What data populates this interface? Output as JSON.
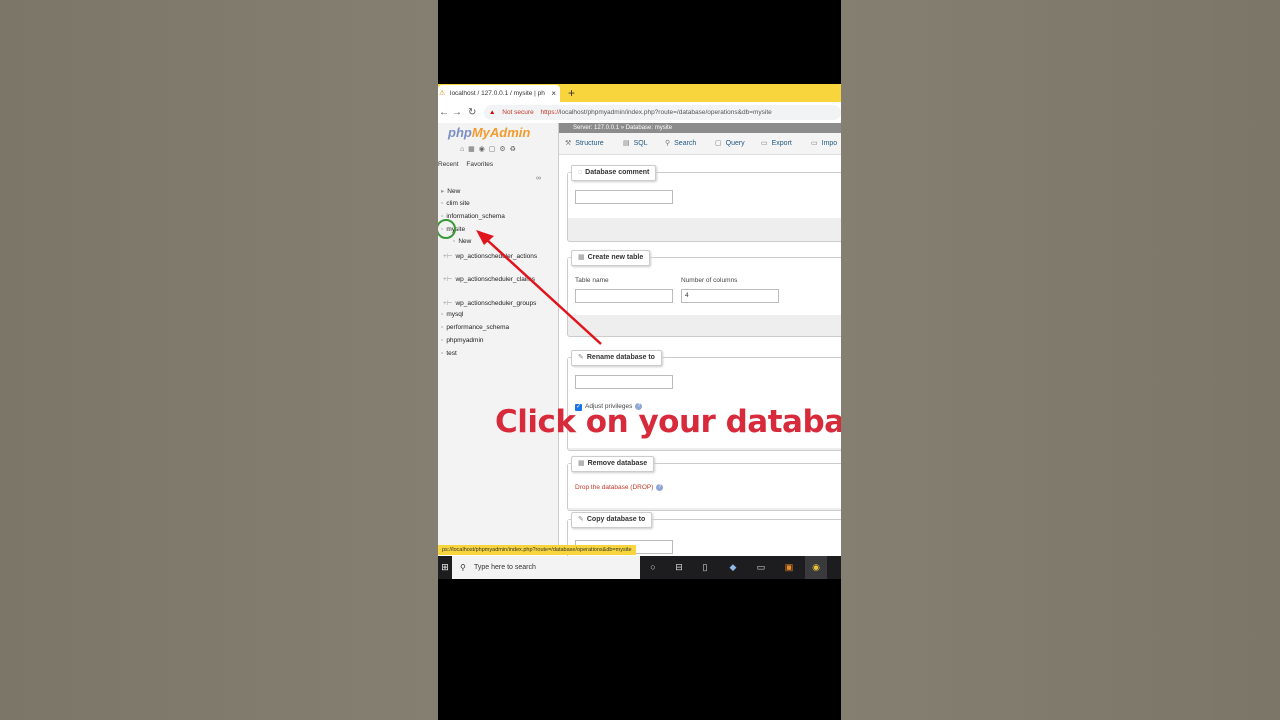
{
  "browser": {
    "tab_title": "localhost / 127.0.0.1 / mysite | ph",
    "tab_close": "×",
    "new_tab": "+",
    "not_secure": "Not secure",
    "url_scheme": "https://",
    "url_rest": "localhost/phpmyadmin/index.php?route=/database/operations&db=mysite"
  },
  "pma": {
    "logo_php": "php",
    "logo_myadmin": "MyAdmin",
    "left_tabs": [
      "Recent",
      "Favorites"
    ],
    "tree": [
      {
        "label": "New"
      },
      {
        "label": "clim site"
      },
      {
        "label": "information_schema"
      },
      {
        "label": "mysite"
      },
      {
        "label": "New"
      },
      {
        "label": "wp_actionscheduler_actions"
      },
      {
        "label": "wp_actionscheduler_claims"
      },
      {
        "label": "wp_actionscheduler_groups"
      },
      {
        "label": "mysql"
      },
      {
        "label": "performance_schema"
      },
      {
        "label": "phpmyadmin"
      },
      {
        "label": "test"
      }
    ],
    "breadcrumb": "Server: 127.0.0.1  »  Database: mysite",
    "menu": [
      "Structure",
      "SQL",
      "Search",
      "Query",
      "Export",
      "Impo"
    ],
    "sections": {
      "db_comment": "Database comment",
      "create_table": "Create new table",
      "table_name_label": "Table name",
      "num_columns_label": "Number of columns",
      "num_columns_value": "4",
      "rename_db": "Rename database to",
      "adjust_privileges": "Adjust privileges",
      "remove_db": "Remove database",
      "drop_link": "Drop the database (DROP)",
      "copy_db": "Copy database to"
    },
    "status_url": "ps://localhost/phpmyadmin/index.php?route=/database/operations&db=mysite"
  },
  "taskbar": {
    "search_placeholder": "Type here to search"
  },
  "annotation": {
    "text": "Click on your database",
    "color": "#d72a3a"
  }
}
